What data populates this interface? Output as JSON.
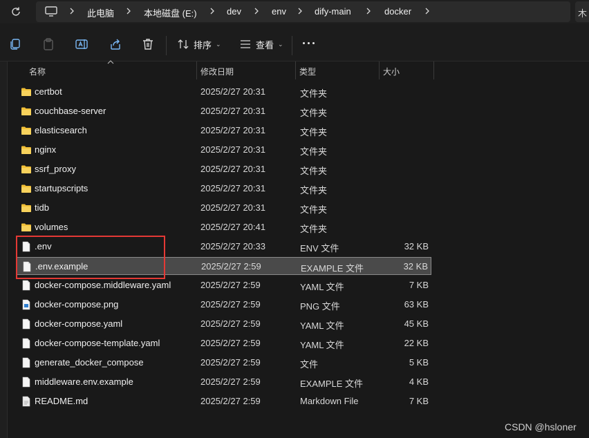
{
  "address_bar": {
    "crumbs": [
      "此电脑",
      "本地磁盘 (E:)",
      "dev",
      "env",
      "dify-main",
      "docker"
    ],
    "overflow_text": "木"
  },
  "toolbar": {
    "sort_label": "排序",
    "view_label": "查看"
  },
  "columns": {
    "name": "名称",
    "modified": "修改日期",
    "type": "类型",
    "size": "大小"
  },
  "files": [
    {
      "name": "certbot",
      "date": "2025/2/27 20:31",
      "type": "文件夹",
      "size": "",
      "icon": "folder-icon"
    },
    {
      "name": "couchbase-server",
      "date": "2025/2/27 20:31",
      "type": "文件夹",
      "size": "",
      "icon": "folder-icon"
    },
    {
      "name": "elasticsearch",
      "date": "2025/2/27 20:31",
      "type": "文件夹",
      "size": "",
      "icon": "folder-icon"
    },
    {
      "name": "nginx",
      "date": "2025/2/27 20:31",
      "type": "文件夹",
      "size": "",
      "icon": "folder-icon"
    },
    {
      "name": "ssrf_proxy",
      "date": "2025/2/27 20:31",
      "type": "文件夹",
      "size": "",
      "icon": "folder-icon"
    },
    {
      "name": "startupscripts",
      "date": "2025/2/27 20:31",
      "type": "文件夹",
      "size": "",
      "icon": "folder-icon"
    },
    {
      "name": "tidb",
      "date": "2025/2/27 20:31",
      "type": "文件夹",
      "size": "",
      "icon": "folder-icon"
    },
    {
      "name": "volumes",
      "date": "2025/2/27 20:41",
      "type": "文件夹",
      "size": "",
      "icon": "folder-icon"
    },
    {
      "name": ".env",
      "date": "2025/2/27 20:33",
      "type": "ENV 文件",
      "size": "32 KB",
      "icon": "file-icon"
    },
    {
      "name": ".env.example",
      "date": "2025/2/27 2:59",
      "type": "EXAMPLE 文件",
      "size": "32 KB",
      "icon": "file-icon",
      "selected": true
    },
    {
      "name": "docker-compose.middleware.yaml",
      "date": "2025/2/27 2:59",
      "type": "YAML 文件",
      "size": "7 KB",
      "icon": "file-icon"
    },
    {
      "name": "docker-compose.png",
      "date": "2025/2/27 2:59",
      "type": "PNG 文件",
      "size": "63 KB",
      "icon": "image-file-icon"
    },
    {
      "name": "docker-compose.yaml",
      "date": "2025/2/27 2:59",
      "type": "YAML 文件",
      "size": "45 KB",
      "icon": "file-icon"
    },
    {
      "name": "docker-compose-template.yaml",
      "date": "2025/2/27 2:59",
      "type": "YAML 文件",
      "size": "22 KB",
      "icon": "file-icon"
    },
    {
      "name": "generate_docker_compose",
      "date": "2025/2/27 2:59",
      "type": "文件",
      "size": "5 KB",
      "icon": "file-icon"
    },
    {
      "name": "middleware.env.example",
      "date": "2025/2/27 2:59",
      "type": "EXAMPLE 文件",
      "size": "4 KB",
      "icon": "file-icon"
    },
    {
      "name": "README.md",
      "date": "2025/2/27 2:59",
      "type": "Markdown File",
      "size": "7 KB",
      "icon": "markdown-file-icon"
    }
  ],
  "watermark": "CSDN @hsloner"
}
